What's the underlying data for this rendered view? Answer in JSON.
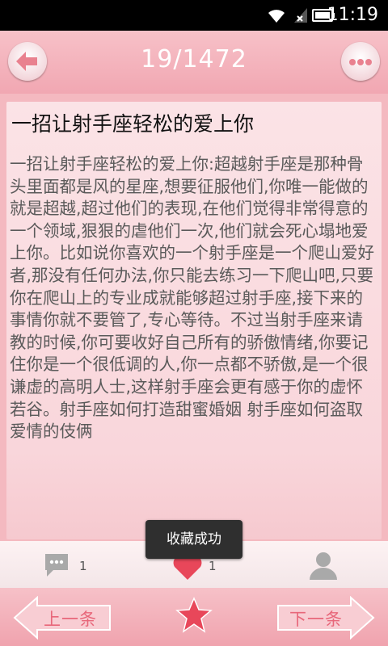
{
  "status_bar": {
    "time": "11:19",
    "icons": [
      "wifi-icon",
      "no-signal-icon",
      "battery-icon"
    ]
  },
  "header": {
    "page_indicator": "19/1472",
    "back_icon": "arrow-left-icon",
    "more_icon": "more-dots-icon"
  },
  "article": {
    "title": "一招让射手座轻松的爱上你",
    "body": "一招让射手座轻松的爱上你:超越射手座是那种骨头里面都是风的星座,想要征服他们,你唯一能做的就是超越,超过他们的表现,在他们觉得非常得意的一个领域,狠狠的虐他们一次,他们就会死心塌地爱上你。比如说你喜欢的一个射手座是一个爬山爱好者,那没有任何办法,你只能去练习一下爬山吧,只要你在爬山上的专业成就能够超过射手座,接下来的事情你就不要管了,专心等待。不过当射手座来请教的时候,你可要收好自己所有的骄傲情绪,你要记住你是一个很低调的人,你一点都不骄傲,是一个很谦虚的高明人士,这样射手座会更有感于你的虚怀若谷。射手座如何打造甜蜜婚姻 射手座如何盗取爱情的伎俩"
  },
  "actions": {
    "comment_count": "1",
    "like_count": "1"
  },
  "toast": {
    "message": "收藏成功"
  },
  "bottom_nav": {
    "prev_label": "上一条",
    "next_label": "下一条"
  },
  "colors": {
    "accent_pink": "#f1a7b2",
    "favorite_red": "#e8475a",
    "nav_text": "#e8677a"
  }
}
